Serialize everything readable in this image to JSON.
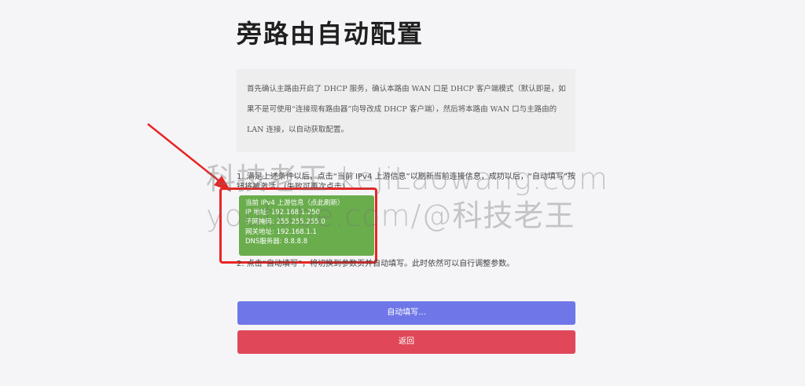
{
  "page": {
    "title": "旁路由自动配置",
    "intro": "首先确认主路由开启了 DHCP 服务，确认本路由 WAN 口是 DHCP 客户端模式（默认即是，如果不是可使用“连接现有路由器”向导改成 DHCP 客户端），然后将本路由 WAN 口与主路由的 LAN 连接，以自动获取配置。",
    "step1": "1. 满足上述条件以后，点击“当前 IPv4 上游信息”以刷新当前连接信息，成功以后，“自动填写”按钮将被激活。(失败可再次点击)",
    "step2": "2. 点击“自动填写”，将切换到参数页并自动填写。此时依然可以自行调整参数。"
  },
  "ipv4_info": {
    "title": "当前 IPv4 上游信息（点此刷新）",
    "ip": "IP 地址: 192.168.1.250",
    "mask": "子网掩码: 255.255.255.0",
    "gateway": "网关地址: 192.168.1.1",
    "dns": "DNS服务器: 8.8.8.8"
  },
  "buttons": {
    "auto_fill": "自动填写...",
    "back": "返回"
  },
  "watermark": {
    "line1": "科技老王 keJiLaowang.com",
    "line2": "youtube.com/@科技老王"
  },
  "colors": {
    "auto_fill_button": "#6f77e8",
    "back_button": "#e0485a",
    "ipv4_box": "#6aad4d",
    "annotation": "#e82525"
  }
}
